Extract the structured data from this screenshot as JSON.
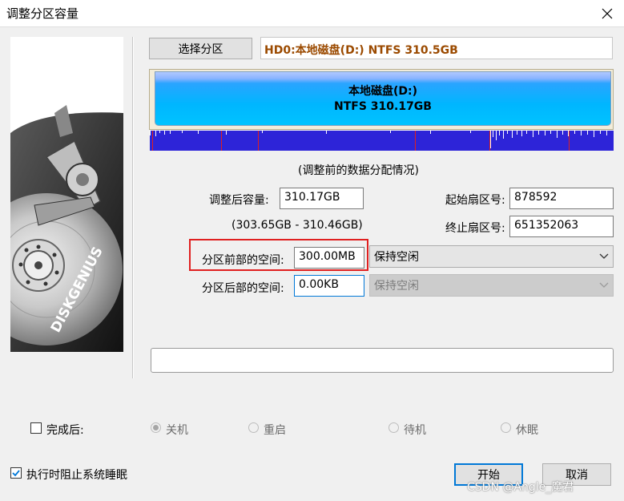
{
  "window": {
    "title": "调整分区容量"
  },
  "disk": {
    "select_button": "选择分区",
    "title": "HD0:本地磁盘(D:) NTFS 310.5GB"
  },
  "partition": {
    "name": "本地磁盘(D:)",
    "fs_size": "NTFS 310.17GB"
  },
  "map": {
    "caption": "(调整前的数据分配情况)"
  },
  "form": {
    "new_size_label": "调整后容量:",
    "new_size_value": "310.17GB",
    "range_text": "(303.65GB - 310.46GB)",
    "start_sector_label": "起始扇区号:",
    "start_sector_value": "878592",
    "end_sector_label": "终止扇区号:",
    "end_sector_value": "651352063",
    "front_space_label": "分区前部的空间:",
    "front_space_value": "300.00MB",
    "front_space_option": "保持空闲",
    "back_space_label": "分区后部的空间:",
    "back_space_value": "0.00KB",
    "back_space_option": "保持空闲"
  },
  "after": {
    "label": "完成后:",
    "options": [
      "关机",
      "重启",
      "待机",
      "休眠"
    ],
    "selected": "关机"
  },
  "prevent_sleep": {
    "label": "执行时阻止系统睡眠",
    "checked": true
  },
  "buttons": {
    "start": "开始",
    "cancel": "取消"
  },
  "logo_text": "DISKGENIUS",
  "watermark": "CSDN @Angle_魔君",
  "colors": {
    "accent": "#0078d7",
    "highlight": "#e02020",
    "disk_title": "#9b4a00",
    "data_map": "#2d24d8"
  }
}
